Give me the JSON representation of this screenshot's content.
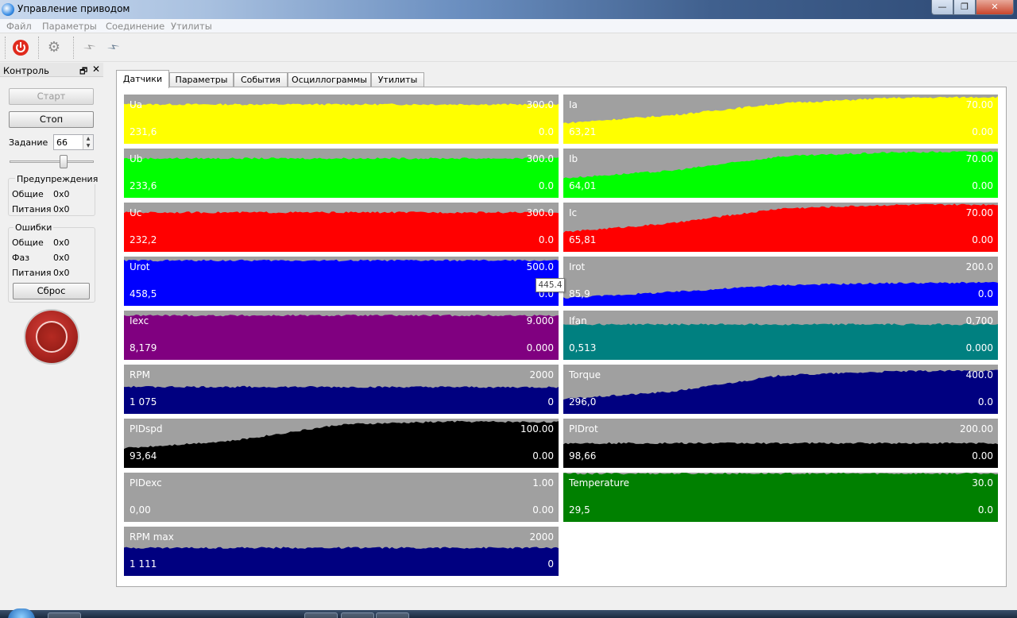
{
  "window": {
    "title": "Управление приводом",
    "controls": {
      "minimize": "—",
      "maximize": "❐",
      "close": "✕"
    }
  },
  "menu": [
    "Файл",
    "Параметры",
    "Соединение",
    "Утилиты"
  ],
  "toolbar": {
    "icons": [
      "power-icon",
      "gear-icon",
      "plug-disconnected-icon",
      "plug-connected-icon"
    ]
  },
  "dock": {
    "title": "Контроль",
    "start_label": "Старт",
    "stop_label": "Стоп",
    "setpoint_label": "Задание",
    "setpoint_value": "66",
    "slider_fraction": 0.66,
    "warnings": {
      "title": "Предупреждения",
      "rows": [
        {
          "label": "Общие",
          "value": "0x0"
        },
        {
          "label": "Питания",
          "value": "0x0"
        }
      ]
    },
    "errors": {
      "title": "Ошибки",
      "rows": [
        {
          "label": "Общие",
          "value": "0x0"
        },
        {
          "label": "Фаз",
          "value": "0x0"
        },
        {
          "label": "Питания",
          "value": "0x0"
        }
      ],
      "reset_label": "Сброс"
    }
  },
  "tabs": [
    "Датчики",
    "Параметры",
    "События",
    "Осциллограммы",
    "Утилиты"
  ],
  "active_tab": 0,
  "tooltip": "445.4",
  "sensors": [
    {
      "name": "Ua",
      "max": "300.0",
      "current": "231,6",
      "min": "0.0",
      "color": "#ffff00",
      "levels": [
        0.8,
        0.8
      ]
    },
    {
      "name": "Ia",
      "max": "70.00",
      "current": "63,21",
      "min": "0.00",
      "color": "#ffff00",
      "levels": [
        0.42,
        0.58,
        0.82,
        0.93,
        0.95
      ]
    },
    {
      "name": "Ub",
      "max": "300.0",
      "current": "233,6",
      "min": "0.0",
      "color": "#00ff00",
      "levels": [
        0.8,
        0.8
      ]
    },
    {
      "name": "Ib",
      "max": "70.00",
      "current": "64,01",
      "min": "0.00",
      "color": "#00ff00",
      "levels": [
        0.4,
        0.55,
        0.84,
        0.92,
        0.94
      ]
    },
    {
      "name": "Uc",
      "max": "300.0",
      "current": "232,2",
      "min": "0.0",
      "color": "#ff0000",
      "levels": [
        0.8,
        0.8
      ]
    },
    {
      "name": "Ic",
      "max": "70.00",
      "current": "65,81",
      "min": "0.00",
      "color": "#ff0000",
      "levels": [
        0.4,
        0.58,
        0.88,
        0.95,
        0.96
      ]
    },
    {
      "name": "Urot",
      "max": "500.0",
      "current": "458,5",
      "min": "0.0",
      "color": "#0000ff",
      "levels": [
        0.92,
        0.92
      ]
    },
    {
      "name": "Irot",
      "max": "200.0",
      "current": "85,9",
      "min": "0.0",
      "color": "#0000ff",
      "levels": [
        0.16,
        0.28,
        0.42,
        0.46,
        0.47
      ]
    },
    {
      "name": "Iexc",
      "max": "9.000",
      "current": "8,179",
      "min": "0.000",
      "color": "#800080",
      "levels": [
        0.9,
        0.9
      ]
    },
    {
      "name": "Ifan",
      "max": "0.700",
      "current": "0,513",
      "min": "0.000",
      "color": "#008080",
      "levels": [
        0.72,
        0.72
      ]
    },
    {
      "name": "RPM",
      "max": "2000",
      "current": "1 075",
      "min": "0",
      "color": "#000080",
      "levels": [
        0.55,
        0.54
      ]
    },
    {
      "name": "Torque",
      "max": "400.0",
      "current": "296,0",
      "min": "0.0",
      "color": "#000080",
      "levels": [
        0.3,
        0.45,
        0.78,
        0.86,
        0.88
      ]
    },
    {
      "name": "PIDspd",
      "max": "100.00",
      "current": "93,64",
      "min": "0.00",
      "color": "#000000",
      "levels": [
        0.4,
        0.55,
        0.88,
        0.94,
        0.93
      ]
    },
    {
      "name": "PIDrot",
      "max": "200.00",
      "current": "98,66",
      "min": "0.00",
      "color": "#000000",
      "levels": [
        0.5,
        0.5
      ]
    },
    {
      "name": "PIDexc",
      "max": "1.00",
      "current": "0,00",
      "min": "0.00",
      "color": "#a0a0a0",
      "levels": [
        0.0,
        0.0
      ]
    },
    {
      "name": "Temperature",
      "max": "30.0",
      "current": "29,5",
      "min": "0.0",
      "color": "#008000",
      "levels": [
        0.98,
        0.98
      ]
    },
    {
      "name": "RPM max",
      "max": "2000",
      "current": "1 111",
      "min": "0",
      "color": "#000080",
      "levels": [
        0.57,
        0.57
      ]
    }
  ]
}
